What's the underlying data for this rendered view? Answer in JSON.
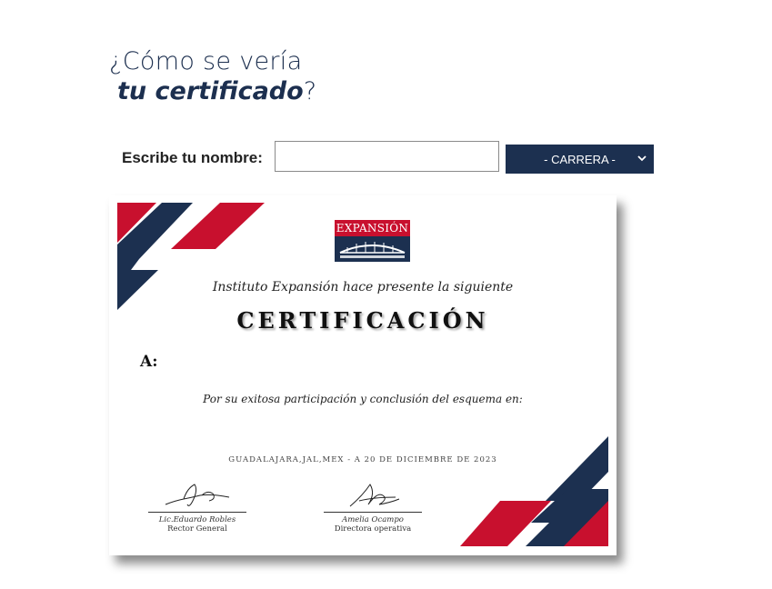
{
  "heading": {
    "line1": "¿Cómo se vería",
    "line2_emphasis": "tu certificado",
    "line2_suffix": "?"
  },
  "form": {
    "name_label": "Escribe tu nombre:",
    "name_value": "",
    "career_selected": "- CARRERA -"
  },
  "certificate": {
    "logo_text": "EXPANSIÓN",
    "intro": "Instituto Expansión hace presente la siguiente",
    "title": "CERTIFICACIÓN",
    "to_label": "A:",
    "reason": "Por su exitosa participación y conclusión del esquema en:",
    "place_date": "GUADALAJARA,JAL,MEX - A 20 DE DICIEMBRE DE 2023",
    "signatures": [
      {
        "name": "Lic.Eduardo Robles",
        "role": "Rector General"
      },
      {
        "name": "Amelia Ocampo",
        "role": "Directora operativa"
      }
    ]
  },
  "colors": {
    "navy": "#1c3050",
    "red": "#c8102e",
    "heading": "#1c2f4f"
  }
}
